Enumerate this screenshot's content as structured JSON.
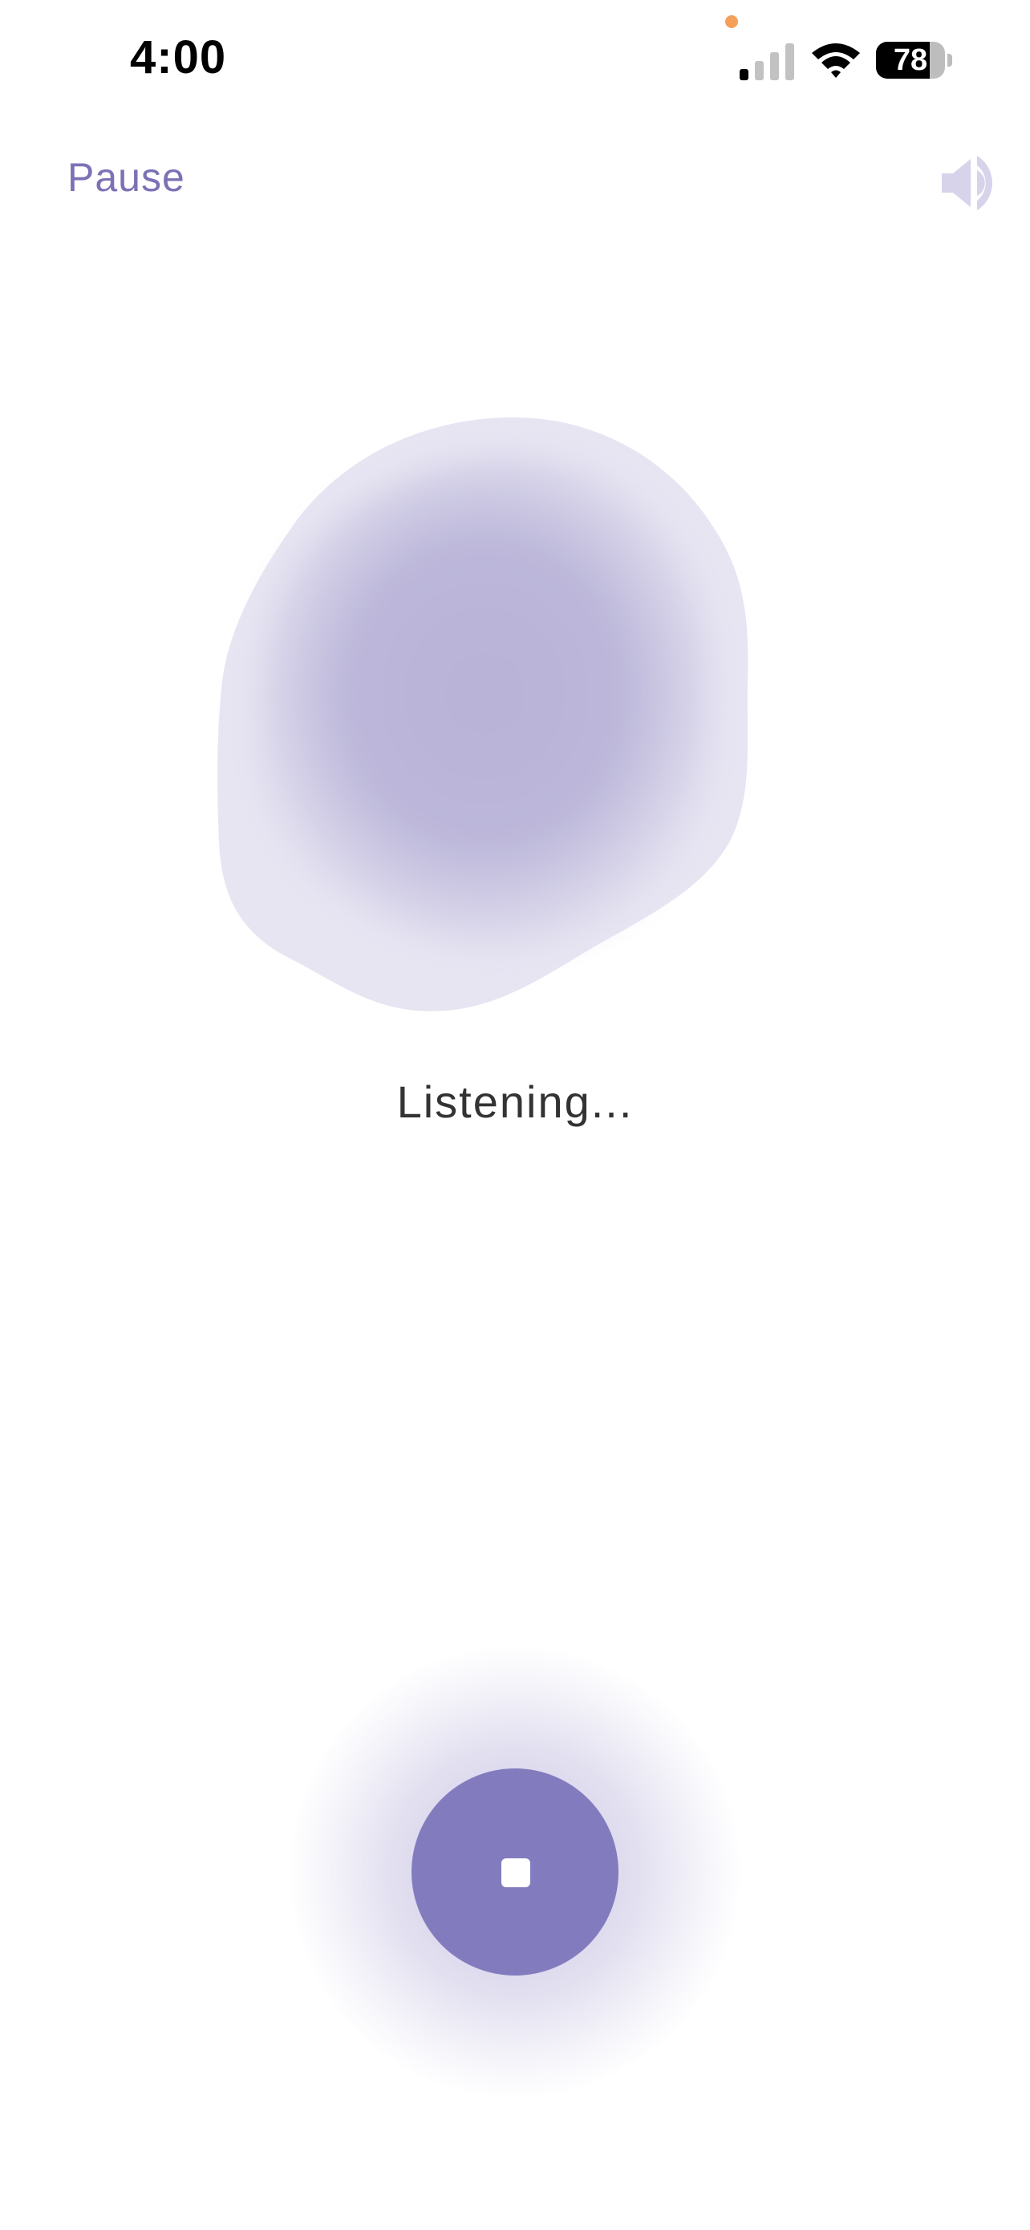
{
  "status_bar": {
    "time": "4:00",
    "battery_level": "78",
    "battery_fraction": 0.78,
    "signal_bars_active": 1,
    "signal_bars_total": 4,
    "privacy_indicator_color": "#f5a05a",
    "icons": [
      "cellular-signal-icon",
      "wifi-icon",
      "battery-icon"
    ]
  },
  "header": {
    "pause_label": "Pause",
    "speaker_icon": "speaker-icon"
  },
  "main": {
    "status_text": "Listening..."
  },
  "controls": {
    "stop_icon": "stop-icon"
  },
  "colors": {
    "accent": "#7f79bb",
    "pause_text": "#7b72b6",
    "speaker_icon": "#d6d3ea",
    "blob_core": "#b7b2d7",
    "blob_edge": "#e7e5f2",
    "stop_button": "#827cbe"
  }
}
